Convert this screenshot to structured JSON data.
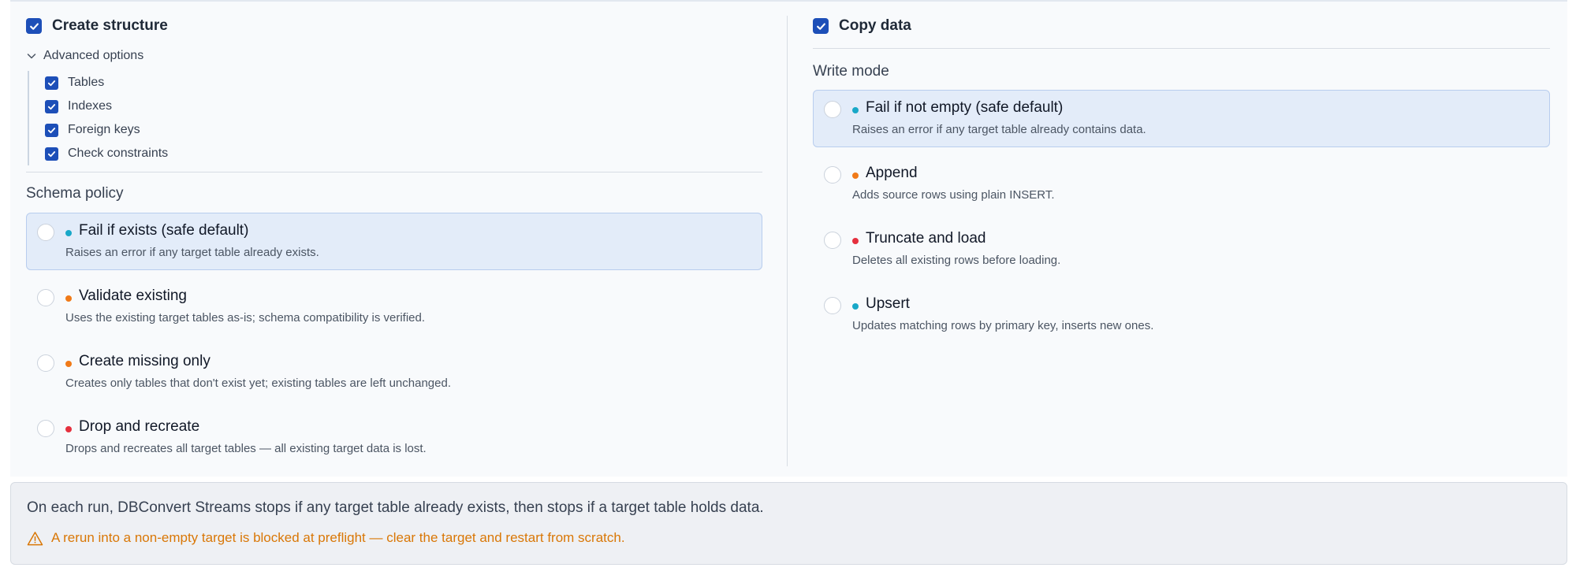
{
  "colors": {
    "accent": "#1d4fb8",
    "safe": "#18a8c8",
    "caution": "#f07a18",
    "danger": "#e5303e",
    "warning_text": "#d97706"
  },
  "structure": {
    "label": "Create structure",
    "checked": true,
    "advanced": {
      "label": "Advanced options",
      "icon": "chevron-down-icon",
      "items": [
        {
          "label": "Tables",
          "checked": true
        },
        {
          "label": "Indexes",
          "checked": true
        },
        {
          "label": "Foreign keys",
          "checked": true
        },
        {
          "label": "Check constraints",
          "checked": true
        }
      ]
    },
    "policy": {
      "title": "Schema policy",
      "options": [
        {
          "title": "Fail if exists (safe default)",
          "desc": "Raises an error if any target table already exists.",
          "level": "safe",
          "selected": true
        },
        {
          "title": "Validate existing",
          "desc": "Uses the existing target tables as-is; schema compatibility is verified.",
          "level": "caution",
          "selected": false
        },
        {
          "title": "Create missing only",
          "desc": "Creates only tables that don't exist yet; existing tables are left unchanged.",
          "level": "caution",
          "selected": false
        },
        {
          "title": "Drop and recreate",
          "desc": "Drops and recreates all target tables — all existing target data is lost.",
          "level": "danger",
          "selected": false
        }
      ]
    }
  },
  "data_copy": {
    "label": "Copy data",
    "checked": true,
    "write_mode": {
      "title": "Write mode",
      "options": [
        {
          "title": "Fail if not empty (safe default)",
          "desc": "Raises an error if any target table already contains data.",
          "level": "safe",
          "selected": true
        },
        {
          "title": "Append",
          "desc": "Adds source rows using plain INSERT.",
          "level": "caution",
          "selected": false
        },
        {
          "title": "Truncate and load",
          "desc": "Deletes all existing rows before loading.",
          "level": "danger",
          "selected": false
        },
        {
          "title": "Upsert",
          "desc": "Updates matching rows by primary key, inserts new ones.",
          "level": "safe",
          "selected": false
        }
      ]
    }
  },
  "footer": {
    "summary": "On each run, DBConvert Streams stops if any target table already exists, then stops if a target table holds data.",
    "warning": "A rerun into a non-empty target is blocked at preflight — clear the target and restart from scratch.",
    "warning_icon": "warning-triangle-icon"
  }
}
